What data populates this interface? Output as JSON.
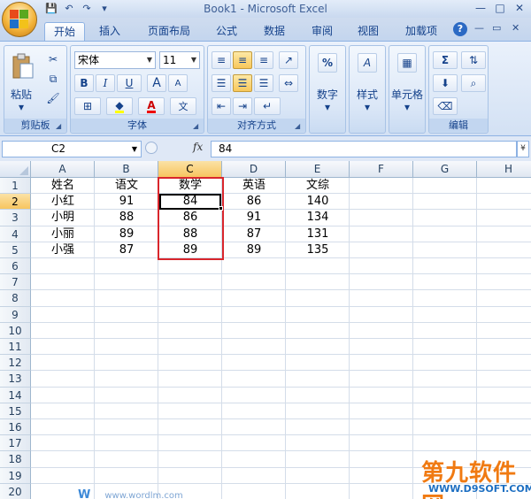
{
  "window": {
    "title": "Book1 - Microsoft Excel",
    "qat": [
      "save-icon",
      "undo-icon",
      "redo-icon",
      "customize-icon"
    ],
    "controls": [
      "—",
      "□",
      "✕"
    ]
  },
  "tabs": [
    "开始",
    "插入",
    "页面布局",
    "公式",
    "数据",
    "审阅",
    "视图",
    "加载项"
  ],
  "active_tab": "开始",
  "ribbon": {
    "clipboard": {
      "label": "剪贴板",
      "paste": "粘贴"
    },
    "font": {
      "label": "字体",
      "font_name": "宋体",
      "font_size": "11",
      "bold": "B",
      "italic": "I",
      "underline": "U",
      "grow": "A",
      "shrink": "A",
      "font_color": "A",
      "phonetic": "文"
    },
    "alignment": {
      "label": "对齐方式"
    },
    "number": {
      "label": "数字",
      "percent": "%"
    },
    "styles": {
      "label": "样式"
    },
    "cells": {
      "label": "单元格"
    },
    "editing": {
      "label": "编辑",
      "sum": "Σ"
    }
  },
  "formula_bar": {
    "name_box": "C2",
    "fx": "fx",
    "value": "84"
  },
  "sheet": {
    "columns": [
      "A",
      "B",
      "C",
      "D",
      "E",
      "F",
      "G",
      "H"
    ],
    "rows": [
      "1",
      "2",
      "3",
      "4",
      "5",
      "6",
      "7",
      "8",
      "9",
      "10",
      "11",
      "12",
      "13",
      "14",
      "15",
      "16",
      "17",
      "18",
      "19",
      "20"
    ],
    "cells": [
      [
        "姓名",
        "语文",
        "数学",
        "英语",
        "文综"
      ],
      [
        "小红",
        "91",
        "84",
        "86",
        "140"
      ],
      [
        "小明",
        "88",
        "86",
        "91",
        "134"
      ],
      [
        "小丽",
        "89",
        "88",
        "87",
        "131"
      ],
      [
        "小强",
        "87",
        "89",
        "89",
        "135"
      ]
    ],
    "selected_cell": "C2"
  },
  "watermark": {
    "brand": "第九软件网",
    "url": "WWW.D9SOFT.COM",
    "site": "www.wordlm.com",
    "mark": "W"
  }
}
